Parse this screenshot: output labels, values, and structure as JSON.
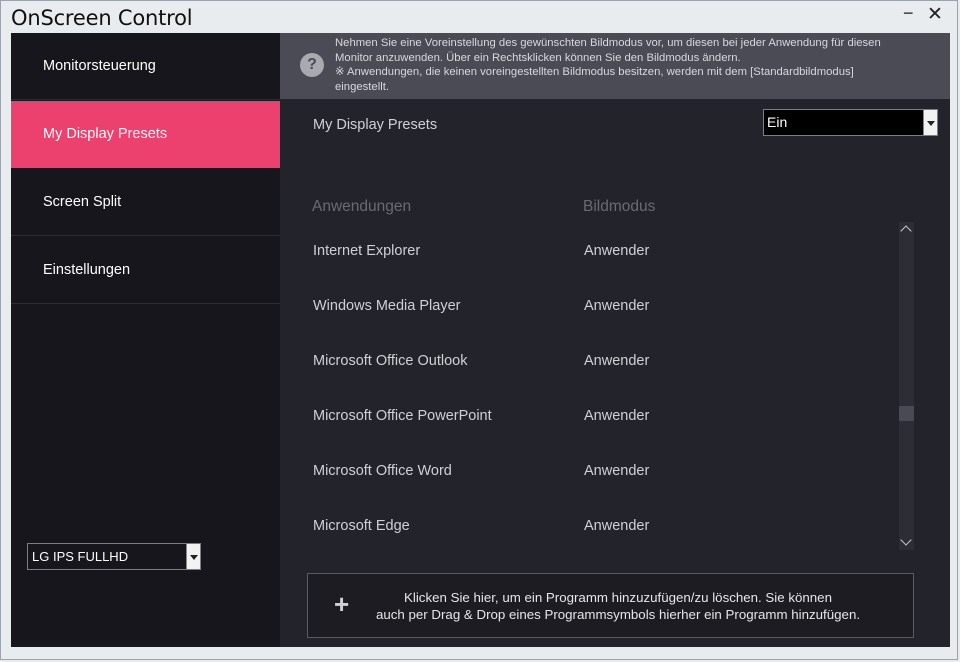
{
  "window": {
    "title": "OnScreen Control",
    "minimize_glyph": "−",
    "close_glyph": "✕"
  },
  "sidebar": {
    "items": [
      {
        "label": "Monitorsteuerung",
        "active": false
      },
      {
        "label": "My Display Presets",
        "active": true
      },
      {
        "label": "Screen Split",
        "active": false
      },
      {
        "label": "Einstellungen",
        "active": false
      }
    ],
    "monitor_select": "LG IPS FULLHD"
  },
  "info": {
    "icon": "question-icon",
    "icon_glyph": "?",
    "line1": "Nehmen Sie eine Voreinstellung des gewünschten Bildmodus vor, um diesen bei jeder Anwendung für diesen",
    "line2": "Monitor anzuwenden. Über ein Rechtsklicken können Sie den Bildmodus ändern.",
    "line3": "※ Anwendungen, die keinen voreingestellten Bildmodus besitzen, werden mit dem [Standardbildmodus]",
    "line4": "eingestellt."
  },
  "presets": {
    "label": "My Display Presets",
    "select_value": "Ein"
  },
  "table": {
    "headers": [
      "Anwendungen",
      "Bildmodus"
    ],
    "rows": [
      {
        "app": "Internet Explorer",
        "mode": "Anwender"
      },
      {
        "app": "Windows Media Player",
        "mode": "Anwender"
      },
      {
        "app": "Microsoft Office Outlook",
        "mode": "Anwender"
      },
      {
        "app": "Microsoft Office PowerPoint",
        "mode": "Anwender"
      },
      {
        "app": "Microsoft Office Word",
        "mode": "Anwender"
      },
      {
        "app": "Microsoft Edge",
        "mode": "Anwender"
      }
    ]
  },
  "add_program": {
    "plus_glyph": "+",
    "line1": "Klicken Sie hier, um ein Programm hinzuzufügen/zu löschen. Sie können",
    "line2": "auch per Drag & Drop eines Programmsymbols hierher ein Programm hinzufügen."
  },
  "colors": {
    "accent": "#ec416e",
    "sidebar_bg": "#16161c",
    "content_bg": "#23232c",
    "infobar_bg": "#4b4b55"
  }
}
